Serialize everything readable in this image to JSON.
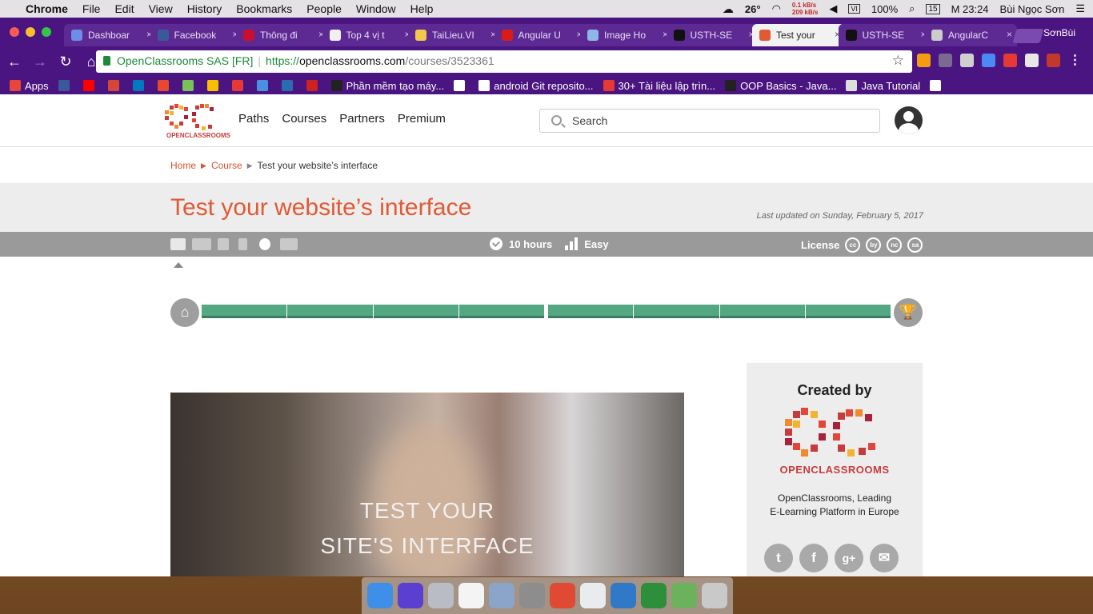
{
  "menubar": {
    "app": "Chrome",
    "items": [
      "File",
      "Edit",
      "View",
      "History",
      "Bookmarks",
      "People",
      "Window",
      "Help"
    ],
    "temperature": "26°",
    "net_up": "0.1 kB/s",
    "net_down": "209 kB/s",
    "battery": "100%",
    "clock": "M 23:24",
    "calendar_day": "15",
    "user": "Bùi Ngọc Sơn",
    "input_method": "VI"
  },
  "browser": {
    "profile_name": "SơnBùi",
    "tabs": [
      {
        "label": "Dashboar",
        "color": "#6c8ee8"
      },
      {
        "label": "Facebook",
        "color": "#3b5998"
      },
      {
        "label": "Thông đi",
        "color": "#c8102e"
      },
      {
        "label": "Top 4 vị t",
        "color": "#f0f0f0"
      },
      {
        "label": "TaiLieu.VI",
        "color": "#f2c94c"
      },
      {
        "label": "Angular U",
        "color": "#dd1b16"
      },
      {
        "label": "Image Ho",
        "color": "#8fb7e6"
      },
      {
        "label": "USTH-SE",
        "color": "#111111"
      },
      {
        "label": "Test your",
        "color": "#e05a35",
        "active": true
      },
      {
        "label": "USTH-SE",
        "color": "#111111"
      },
      {
        "label": "AngularC",
        "color": "#cccccc"
      }
    ],
    "address": {
      "security_label": "OpenClassrooms SAS [FR]",
      "scheme": "https://",
      "host": "openclassrooms.com",
      "path": "/courses/3523361"
    },
    "bookmarks": [
      {
        "label": "Apps",
        "color": "#e8453c"
      },
      {
        "label": "",
        "color": "#3b5998"
      },
      {
        "label": "",
        "color": "#ff0000"
      },
      {
        "label": "",
        "color": "#d44638"
      },
      {
        "label": "",
        "color": "#0079bf"
      },
      {
        "label": "",
        "color": "#e6492d"
      },
      {
        "label": "",
        "color": "#78c257"
      },
      {
        "label": "",
        "color": "#f6c000"
      },
      {
        "label": "",
        "color": "#e53935"
      },
      {
        "label": "",
        "color": "#4a90e2"
      },
      {
        "label": "",
        "color": "#2b6cb0"
      },
      {
        "label": "",
        "color": "#cc2222"
      },
      {
        "label": "Phần mềm tạo máy...",
        "color": "#222222"
      },
      {
        "label": "",
        "color": "#ffffff"
      },
      {
        "label": "android Git reposito...",
        "color": "#ffffff"
      },
      {
        "label": "30+ Tài liệu lập trìn...",
        "color": "#e53935"
      },
      {
        "label": "OOP Basics - Java...",
        "color": "#222222"
      },
      {
        "label": "Java Tutorial",
        "color": "#dddddd"
      },
      {
        "label": "",
        "color": "#ffffff"
      }
    ]
  },
  "site": {
    "logo_text": "OPENCLASSROOMS",
    "nav": [
      "Paths",
      "Courses",
      "Partners",
      "Premium"
    ],
    "search_placeholder": "Search",
    "breadcrumb": {
      "home": "Home",
      "course": "Course",
      "current": "Test your website’s interface"
    },
    "title": "Test your website’s interface",
    "last_updated": "Last updated on Sunday, February 5, 2017",
    "duration": "10 hours",
    "difficulty": "Easy",
    "license_label": "License",
    "license_icons": [
      "cc",
      "by",
      "nc",
      "sa"
    ],
    "progress_segments": 8,
    "video_line1": "TEST YOUR",
    "video_line2": "SITE'S INTERFACE",
    "sidebar": {
      "heading": "Created by",
      "brand": "OPENCLASSROOMS",
      "desc_line1": "OpenClassrooms, Leading",
      "desc_line2": "E-Learning Platform in Europe",
      "social": [
        "twitter",
        "facebook",
        "google-plus",
        "email"
      ]
    }
  },
  "dock": {
    "apps": [
      {
        "name": "finder",
        "color": "#3d8fe8"
      },
      {
        "name": "siri",
        "color": "#5b3fd1"
      },
      {
        "name": "launchpad",
        "color": "#b9bcc4"
      },
      {
        "name": "calendar",
        "color": "#f4f4f4"
      },
      {
        "name": "preview",
        "color": "#8aa5c9"
      },
      {
        "name": "system-preferences",
        "color": "#8d8d8d"
      },
      {
        "name": "bookmark-app",
        "color": "#e04a32"
      },
      {
        "name": "chrome",
        "color": "#e9ecef"
      },
      {
        "name": "visual-studio-code",
        "color": "#2f79c7"
      },
      {
        "name": "utorrent",
        "color": "#2e8f3a"
      },
      {
        "name": "maps",
        "color": "#6cb25c"
      },
      {
        "name": "trash",
        "color": "#c9c9c9"
      }
    ]
  }
}
